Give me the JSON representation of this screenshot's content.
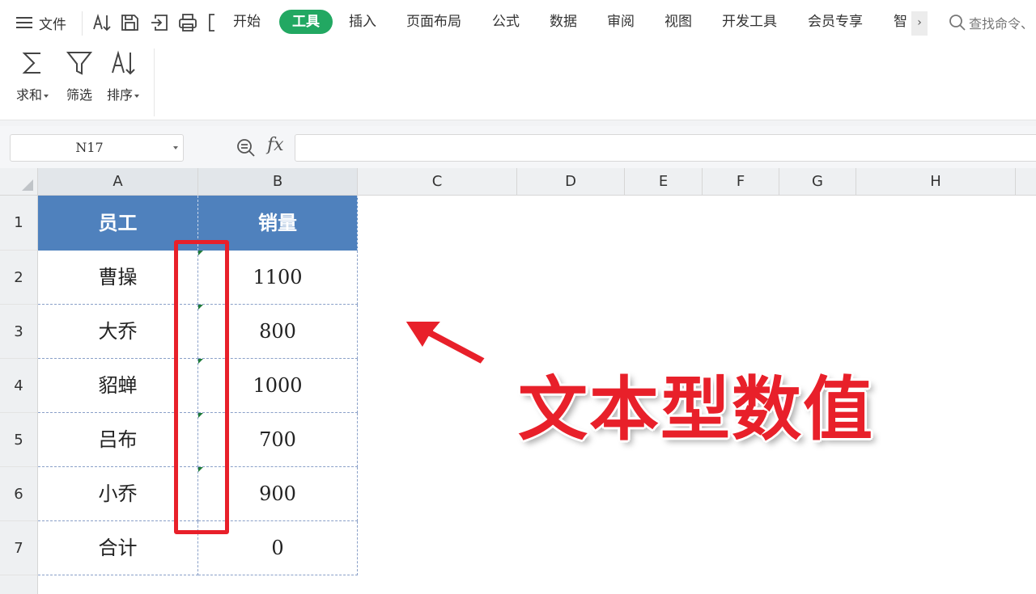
{
  "menubar": {
    "file_label": "文件",
    "tabs": [
      {
        "label": "开始",
        "active": false
      },
      {
        "label": "工具",
        "active": true
      },
      {
        "label": "插入",
        "active": false
      },
      {
        "label": "页面布局",
        "active": false
      },
      {
        "label": "公式",
        "active": false
      },
      {
        "label": "数据",
        "active": false
      },
      {
        "label": "审阅",
        "active": false
      },
      {
        "label": "视图",
        "active": false
      },
      {
        "label": "开发工具",
        "active": false
      },
      {
        "label": "会员专享",
        "active": false
      },
      {
        "label": "智",
        "active": false
      }
    ],
    "more_label": "›",
    "search_placeholder": "查找命令、",
    "accent_color": "#22a862"
  },
  "ribbon": {
    "buttons": [
      {
        "label": "求和",
        "icon": "sum-icon",
        "has_dropdown": true
      },
      {
        "label": "筛选",
        "icon": "filter-icon",
        "has_dropdown": false
      },
      {
        "label": "排序",
        "icon": "sort-icon",
        "has_dropdown": true
      }
    ]
  },
  "formula_bar": {
    "name_box": "N17",
    "fx_label": "fx",
    "formula": ""
  },
  "sheet": {
    "columns": [
      "A",
      "B",
      "C",
      "D",
      "E",
      "F",
      "G",
      "H"
    ],
    "rows": [
      "1",
      "2",
      "3",
      "4",
      "5",
      "6",
      "7"
    ],
    "header_color": "#4f81bd",
    "cells": [
      [
        "员工",
        "销量"
      ],
      [
        "曹操",
        "1100"
      ],
      [
        "大乔",
        "800"
      ],
      [
        "貂蝉",
        "1000"
      ],
      [
        "吕布",
        "700"
      ],
      [
        "小乔",
        "900"
      ],
      [
        "合计",
        "0"
      ]
    ]
  },
  "annotation": {
    "text": "文本型数值",
    "color": "#e8202a"
  }
}
